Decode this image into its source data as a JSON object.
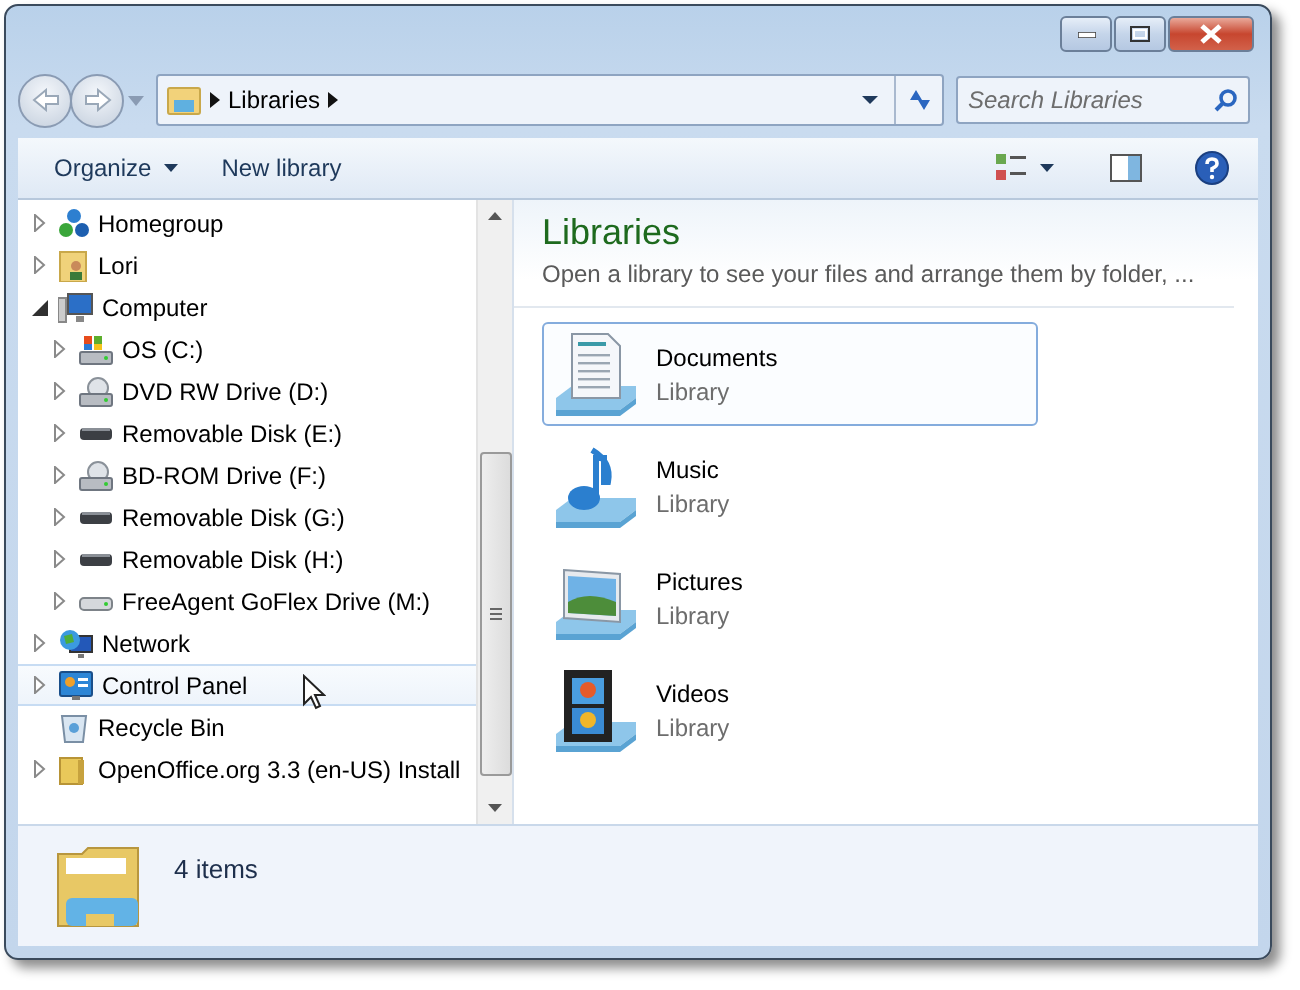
{
  "address_bar": {
    "crumbs": [
      "Libraries"
    ]
  },
  "search": {
    "placeholder": "Search Libraries"
  },
  "toolbar": {
    "buttons": [
      {
        "label": "Organize",
        "dropdown": true
      },
      {
        "label": "New library",
        "dropdown": false
      }
    ]
  },
  "navigation": {
    "items": [
      {
        "label": "Homegroup",
        "kind": "homegroup",
        "expandable": true,
        "expanded": false,
        "highlighted": false
      },
      {
        "label": "Lori",
        "kind": "user",
        "expandable": true,
        "expanded": false,
        "highlighted": false
      },
      {
        "label": "Computer",
        "kind": "computer",
        "expandable": true,
        "expanded": true,
        "highlighted": false,
        "children": [
          {
            "label": "OS (C:)",
            "kind": "system",
            "expandable": true,
            "expanded": false,
            "highlighted": false
          },
          {
            "label": "DVD RW Drive (D:)",
            "kind": "optical",
            "expandable": true,
            "expanded": false,
            "highlighted": false
          },
          {
            "label": "Removable Disk (E:)",
            "kind": "removable",
            "expandable": true,
            "expanded": false,
            "highlighted": false
          },
          {
            "label": "BD-ROM Drive (F:)",
            "kind": "optical",
            "expandable": true,
            "expanded": false,
            "highlighted": false
          },
          {
            "label": "Removable Disk (G:)",
            "kind": "removable",
            "expandable": true,
            "expanded": false,
            "highlighted": false
          },
          {
            "label": "Removable Disk (H:)",
            "kind": "removable",
            "expandable": true,
            "expanded": false,
            "highlighted": false
          },
          {
            "label": "FreeAgent GoFlex Drive (M:)",
            "kind": "external",
            "expandable": true,
            "expanded": false,
            "highlighted": false
          }
        ]
      },
      {
        "label": "Network",
        "kind": "network",
        "expandable": true,
        "expanded": false,
        "highlighted": false
      },
      {
        "label": "Control Panel",
        "kind": "panel",
        "expandable": true,
        "expanded": false,
        "highlighted": true
      },
      {
        "label": "Recycle Bin",
        "kind": "bin",
        "expandable": false,
        "highlighted": false
      },
      {
        "label": "OpenOffice.org 3.3 (en-US) Install",
        "kind": "folder",
        "expandable": true,
        "expanded": false,
        "highlighted": false
      }
    ]
  },
  "content": {
    "title": "Libraries",
    "subtitle": "Open a library to see your files and arrange them by folder, ...",
    "libraries": [
      {
        "name": "Documents",
        "type": "Library",
        "kind": "documents",
        "selected": true
      },
      {
        "name": "Music",
        "type": "Library",
        "kind": "music",
        "selected": false
      },
      {
        "name": "Pictures",
        "type": "Library",
        "kind": "pictures",
        "selected": false
      },
      {
        "name": "Videos",
        "type": "Library",
        "kind": "videos",
        "selected": false
      }
    ]
  },
  "status_bar": {
    "text": "4 items"
  }
}
